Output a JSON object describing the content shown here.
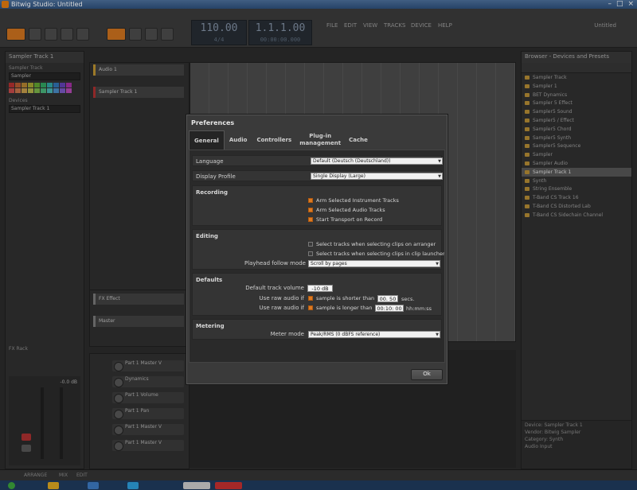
{
  "window": {
    "title": "Bitwig Studio: Untitled"
  },
  "transport": {
    "tempo": "110.00",
    "signature": "4/4",
    "position": "1.1.1.00",
    "time": "00:00:00.000"
  },
  "toolbar": {
    "menu_items": [
      "FILE",
      "EDIT",
      "VIEW",
      "TRACKS",
      "DEVICE",
      "HELP"
    ],
    "project": "Untitled"
  },
  "left_panel": {
    "header": "Sampler Track 1",
    "label1": "Sampler Track",
    "field1": "Sampler",
    "label2": "Devices",
    "field2": "Sampler Track 1",
    "swatch_colors": [
      "#b03030",
      "#b05830",
      "#b08030",
      "#a0a030",
      "#60a030",
      "#30a060",
      "#30a0a0",
      "#3070b0",
      "#6040b0",
      "#a030a0",
      "#c04848",
      "#c07048",
      "#c09848",
      "#b0b048",
      "#78b048",
      "#48b078",
      "#48b0b0",
      "#4888c0",
      "#7858c0",
      "#b048b0"
    ],
    "meter_label": "-0.0 dB",
    "fx_label": "FX Rack"
  },
  "tracks": {
    "items": [
      {
        "label": "Audio 1"
      },
      {
        "label": "Sampler Track 1"
      }
    ],
    "effects_label": "FX Effect",
    "master_label": "Master"
  },
  "devices": {
    "items": [
      "Part 1 Master V",
      "Dynamics",
      "Part 1 Volume",
      "Part 1 Pan",
      "Part 1 Master V",
      "Part 1 Master V"
    ]
  },
  "browser": {
    "header": "Browser - Devices and Presets",
    "items": [
      "Sampler Track",
      "Sampler 1",
      "BET Dynamics",
      "Sampler 5 Effect",
      "Sampler5 Sound",
      "Sampler5 / Effect",
      "Sampler5 Chord",
      "Sampler5 Synth",
      "Sampler5 Sequence",
      "Sampler",
      "Sampler Audio",
      "Sampler Track 1",
      "Synth",
      "String Ensemble",
      "T-Band CS Track 16",
      "T-Band CS Distorted Lab",
      "T-Band CS Sidechain Channel"
    ],
    "selected_index": 11,
    "footer": [
      "Device: Sampler Track 1",
      "Vendor: Bitwig Sampler",
      "Category: Synth",
      "Audio Input"
    ]
  },
  "dialog": {
    "title": "Preferences",
    "tabs": [
      {
        "label": "General",
        "active": true
      },
      {
        "label": "Audio",
        "active": false
      },
      {
        "label": "Controllers",
        "active": false
      },
      {
        "label": "Plug-in management",
        "active": false
      },
      {
        "label": "Cache",
        "active": false
      }
    ],
    "language": {
      "label": "Language",
      "value": "Default (Deutsch (Deutschland))"
    },
    "display_profile": {
      "label": "Display Profile",
      "value": "Single Display (Large)"
    },
    "recording": {
      "title": "Recording",
      "options": [
        {
          "label": "Arm Selected Instrument Tracks",
          "checked": true
        },
        {
          "label": "Arm Selected Audio Tracks",
          "checked": true
        },
        {
          "label": "Start Transport on Record",
          "checked": true
        }
      ]
    },
    "editing": {
      "title": "Editing",
      "options": [
        {
          "label": "Select tracks when selecting clips on arranger",
          "checked": false
        },
        {
          "label": "Select tracks when selecting clips in clip launcher",
          "checked": false
        }
      ],
      "playhead_label": "Playhead follow mode",
      "playhead_value": "Scroll by pages"
    },
    "defaults": {
      "title": "Defaults",
      "volume_label": "Default track volume",
      "volume_value": "-10 dB",
      "raw_short_label": "Use raw audio if",
      "raw_short_check": "sample is shorter than",
      "raw_short_value": "00. 50",
      "raw_short_unit": "secs.",
      "raw_long_label": "Use raw audio if",
      "raw_long_check": "sample is longer than",
      "raw_long_value": "00:10: 00",
      "raw_long_unit": "hh:mm:ss"
    },
    "metering": {
      "title": "Metering",
      "mode_label": "Meter mode",
      "mode_value": "Peak/RMS (0 dBFS reference)"
    },
    "ok_label": "Ok"
  },
  "statusbar": {
    "items": [
      "ARRANGE",
      "MIX",
      "EDIT"
    ]
  }
}
